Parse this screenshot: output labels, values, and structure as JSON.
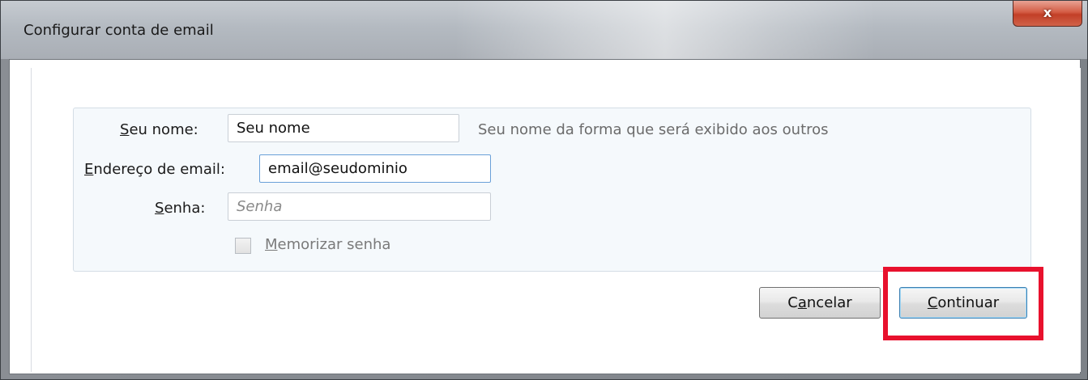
{
  "window": {
    "title": "Configurar conta de email",
    "close_label": "x"
  },
  "form": {
    "name": {
      "label_accel": "S",
      "label_rest": "eu nome:",
      "value": "Seu nome",
      "hint": "Seu nome da forma que será exibido aos outros"
    },
    "email": {
      "label_accel": "E",
      "label_rest": "ndereço de email:",
      "value": "email@seudominio"
    },
    "password": {
      "label_accel": "S",
      "label_rest": "enha:",
      "placeholder": "Senha"
    },
    "remember": {
      "label_accel": "M",
      "label_rest": "emorizar senha",
      "checked": false,
      "enabled": false
    }
  },
  "buttons": {
    "cancel": {
      "pre": "C",
      "accel": "a",
      "post": "ncelar"
    },
    "continue": {
      "pre": "",
      "accel": "C",
      "post": "ontinuar"
    }
  },
  "annotation": {
    "color": "#e8112d"
  }
}
